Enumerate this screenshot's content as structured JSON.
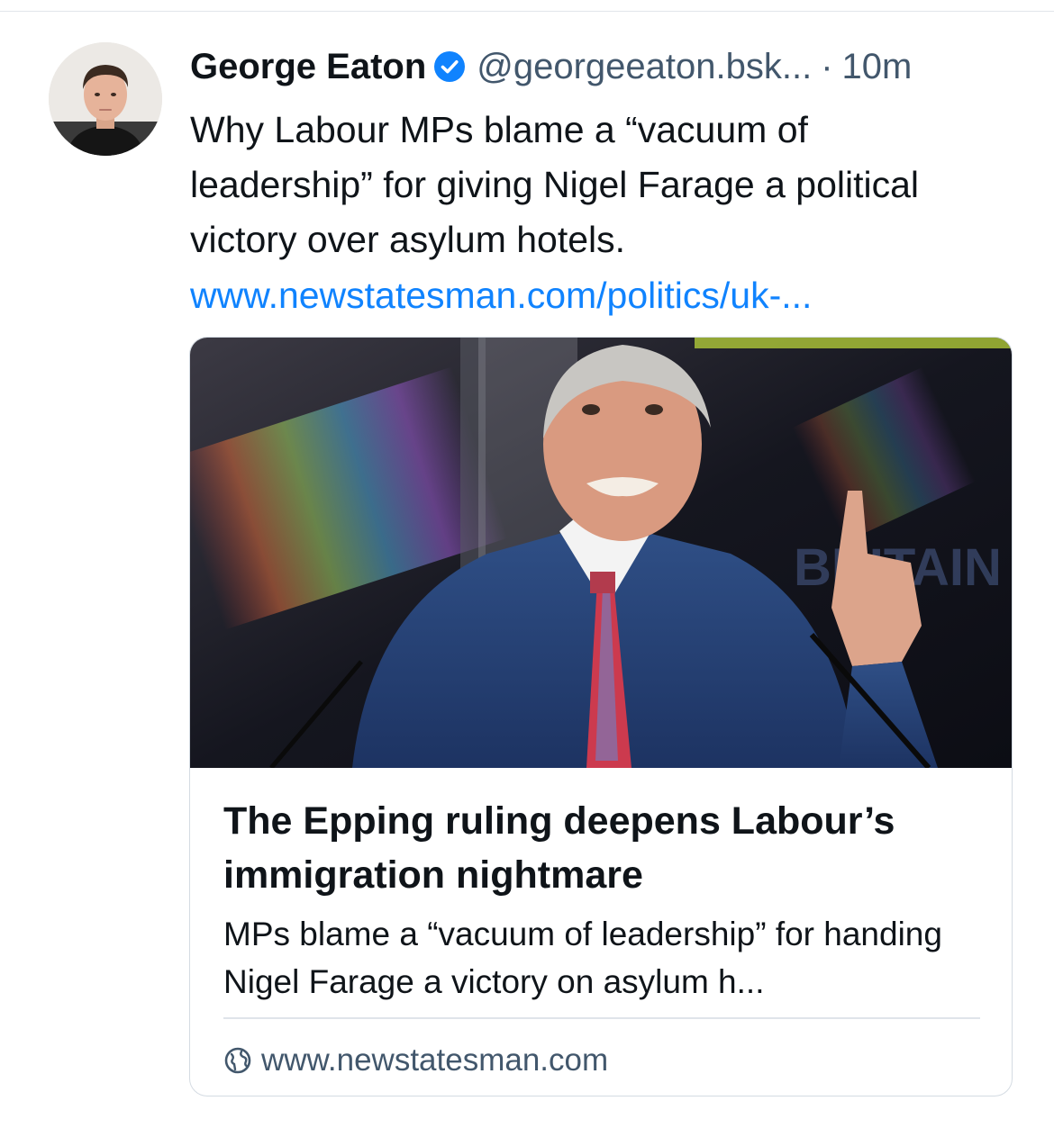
{
  "post": {
    "author": {
      "display_name": "George Eaton",
      "handle": "@georgeeaton.bsk...",
      "verified": true
    },
    "separator": "·",
    "timestamp": "10m",
    "text": "Why Labour MPs blame a “vacuum of leadership” for giving Nigel Farage a political victory over asylum hotels.",
    "link_text": "www.newstatesman.com/politics/uk-..."
  },
  "link_card": {
    "title": "The Epping ruling deepens Labour’s immigration nightmare",
    "description": "MPs blame a “vacuum of leadership” for handing Nigel Farage a victory on asylum h...",
    "domain": "www.newstatesman.com",
    "image_icon": "man-speaking-photo",
    "domain_icon": "globe-icon"
  },
  "colors": {
    "link": "#1083fe",
    "verified_badge": "#1083fe",
    "muted_text": "#42576c",
    "border": "#d4dbe2"
  }
}
